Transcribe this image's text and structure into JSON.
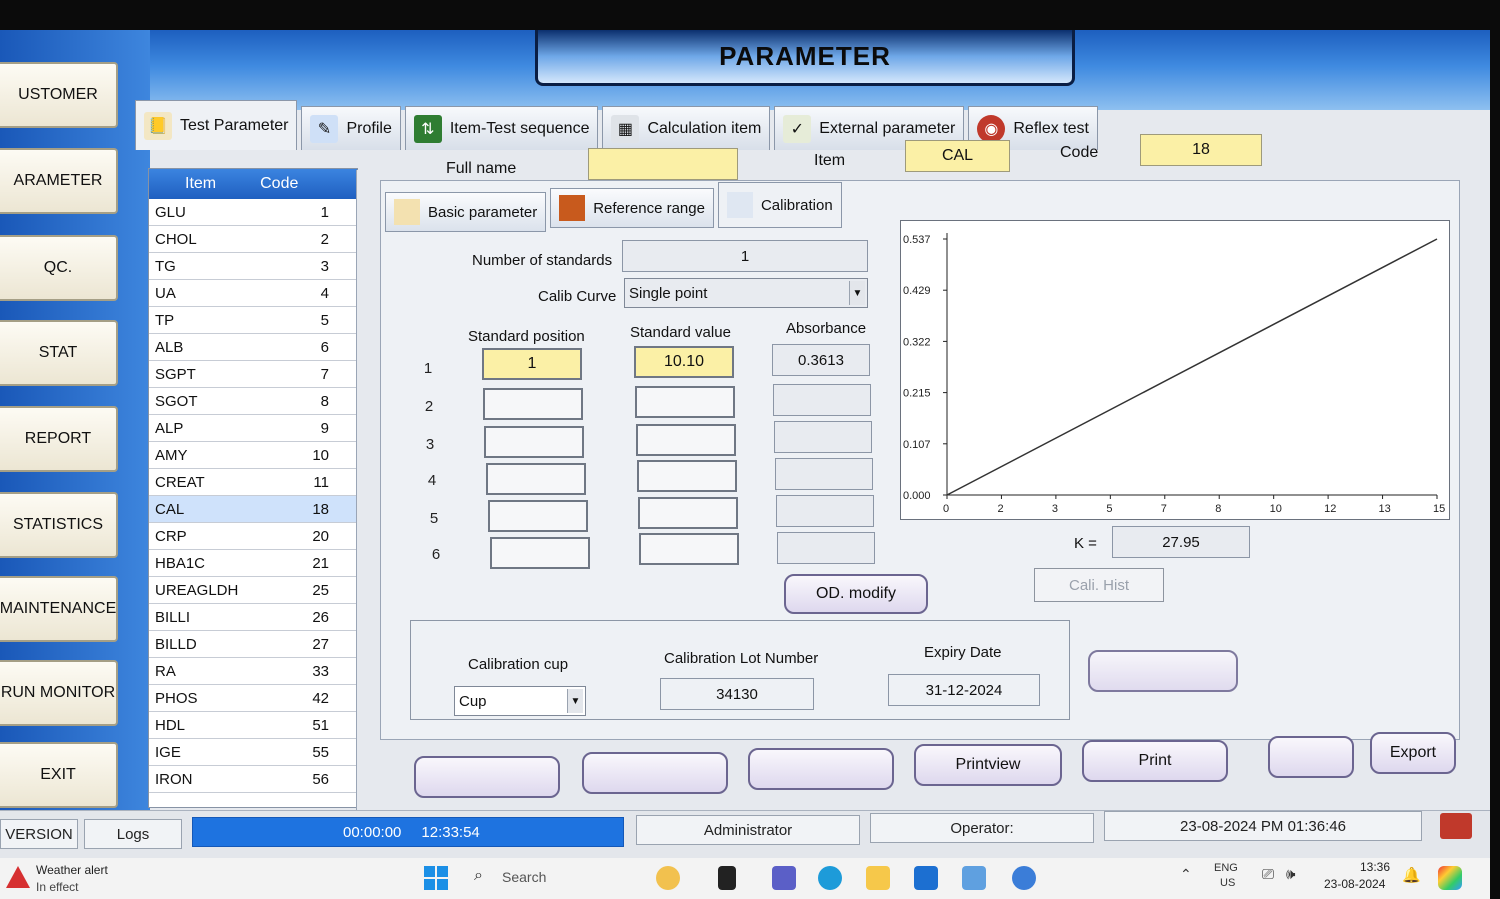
{
  "title": "PARAMETER",
  "menu": [
    "USTOMER",
    "ARAMETER",
    "QC.",
    "STAT",
    "REPORT",
    "STATISTICS",
    "MAINTENANCE",
    "RUN MONITOR",
    "EXIT"
  ],
  "tabs": [
    "Test Parameter",
    "Profile",
    "Item-Test sequence",
    "Calculation item",
    "External parameter",
    "Reflex test"
  ],
  "top_fields": {
    "full_name_label": "Full name",
    "full_name": "",
    "item_label": "Item",
    "item": "CAL",
    "code_label": "Code",
    "code": "18"
  },
  "item_table": {
    "headers": [
      "Item",
      "Code"
    ],
    "rows": [
      [
        "GLU",
        "1"
      ],
      [
        "CHOL",
        "2"
      ],
      [
        "TG",
        "3"
      ],
      [
        "UA",
        "4"
      ],
      [
        "TP",
        "5"
      ],
      [
        "ALB",
        "6"
      ],
      [
        "SGPT",
        "7"
      ],
      [
        "SGOT",
        "8"
      ],
      [
        "ALP",
        "9"
      ],
      [
        "AMY",
        "10"
      ],
      [
        "CREAT",
        "11"
      ],
      [
        "CAL",
        "18"
      ],
      [
        "CRP",
        "20"
      ],
      [
        "HBA1C",
        "21"
      ],
      [
        "UREAGLDH",
        "25"
      ],
      [
        "BILLI",
        "26"
      ],
      [
        "BILLD",
        "27"
      ],
      [
        "RA",
        "33"
      ],
      [
        "PHOS",
        "42"
      ],
      [
        "HDL",
        "51"
      ],
      [
        "IGE",
        "55"
      ],
      [
        "IRON",
        "56"
      ]
    ]
  },
  "subtabs": [
    "Basic parameter",
    "Reference range",
    "Calibration"
  ],
  "calibration": {
    "num_standards_label": "Number of standards",
    "num_standards": "1",
    "calib_curve_label": "Calib Curve",
    "calib_curve": "Single point",
    "col_position": "Standard position",
    "col_value": "Standard value",
    "col_absorbance": "Absorbance",
    "row_numbers": [
      "1",
      "2",
      "3",
      "4",
      "5",
      "6"
    ],
    "std_position_1": "1",
    "std_value_1": "10.10",
    "absorbance_1": "0.3613",
    "k_label": "K =",
    "k_value": "27.95",
    "od_modify": "OD. modify",
    "cali_hist": "Cali. Hist"
  },
  "chart_data": {
    "type": "line",
    "y_ticks": [
      "0.537",
      "0.429",
      "0.322",
      "0.215",
      "0.107",
      "0.000"
    ],
    "x_ticks": [
      "0",
      "2",
      "3",
      "5",
      "7",
      "8",
      "10",
      "12",
      "13",
      "15"
    ],
    "series": [
      {
        "x": [
          0,
          15
        ],
        "y": [
          0.0,
          0.537
        ]
      }
    ],
    "xlim": [
      0,
      15
    ],
    "ylim": [
      0,
      0.537
    ]
  },
  "cal_group": {
    "cup_label": "Calibration cup",
    "cup_value": "Cup",
    "lot_label": "Calibration Lot Number",
    "lot_value": "34130",
    "expiry_label": "Expiry Date",
    "expiry_value": "31-12-2024"
  },
  "bottom_buttons": {
    "printview": "Printview",
    "print": "Print",
    "export": "Export"
  },
  "status": {
    "version": "VERSION",
    "logs": "Logs",
    "progress_time": "00:00:00",
    "clock": "12:33:54",
    "user": "Administrator",
    "operator": "Operator:",
    "datetime": "23-08-2024  PM  01:36:46"
  },
  "taskbar": {
    "weather_title": "Weather alert",
    "weather_sub": "In effect",
    "search": "Search",
    "lang1": "ENG",
    "lang2": "US",
    "time": "13:36",
    "date": "23-08-2024"
  },
  "colors": {
    "header_blue": "#2f78d6",
    "field_yellow": "#fbf0a6",
    "button_purple": "#ded8ee"
  }
}
